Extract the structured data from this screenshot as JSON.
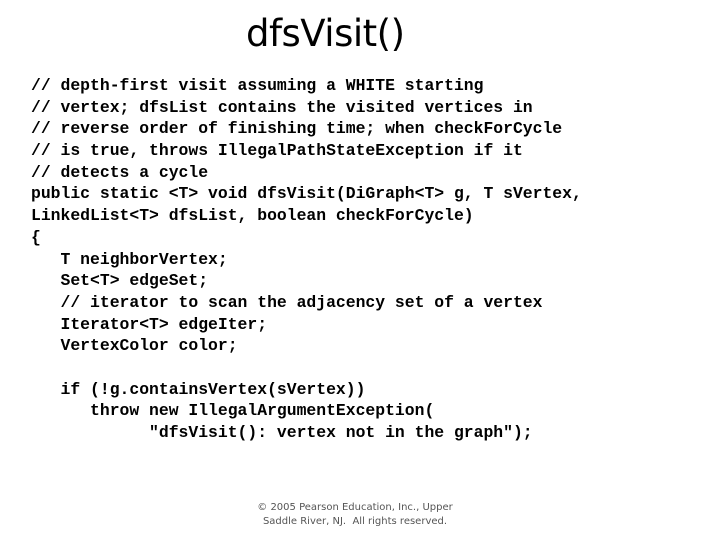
{
  "slide": {
    "title": "dfsVisit()",
    "code_lines": [
      "// depth-first visit assuming a WHITE starting",
      "// vertex; dfsList contains the visited vertices in",
      "// reverse order of finishing time; when checkForCycle",
      "// is true, throws IllegalPathStateException if it",
      "// detects a cycle",
      "public static <T> void dfsVisit(DiGraph<T> g, T sVertex,",
      "LinkedList<T> dfsList, boolean checkForCycle)",
      "{",
      "   T neighborVertex;",
      "   Set<T> edgeSet;",
      "   // iterator to scan the adjacency set of a vertex",
      "   Iterator<T> edgeIter;",
      "   VertexColor color;",
      "",
      "   if (!g.containsVertex(sVertex))",
      "      throw new IllegalArgumentException(",
      "            \"dfsVisit(): vertex not in the graph\");"
    ],
    "footer": {
      "line1": "© 2005 Pearson Education, Inc., Upper",
      "line2": "Saddle River, NJ.  All rights reserved."
    }
  }
}
